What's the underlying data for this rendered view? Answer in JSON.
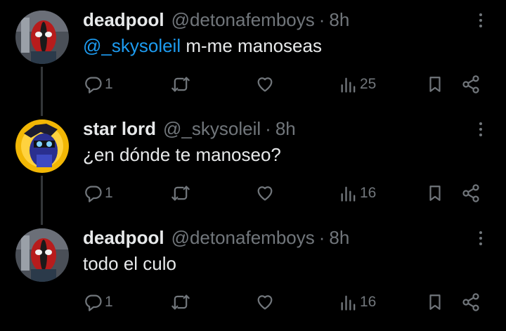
{
  "colors": {
    "background": "#000000",
    "text": "#e7e9ea",
    "muted": "#71767b",
    "link": "#1d9bf0",
    "thread_line": "#333639"
  },
  "tweets": [
    {
      "display_name": "deadpool",
      "handle": "@detonafemboys",
      "separator": "·",
      "time": "8h",
      "mention": "@_skysoleil",
      "text": "m-me manoseas",
      "replies": "1",
      "views": "25",
      "avatar": "deadpool-avatar"
    },
    {
      "display_name": "star lord",
      "handle": "@_skysoleil",
      "separator": "·",
      "time": "8h",
      "mention": "",
      "text": "¿en dónde te manoseo?",
      "replies": "1",
      "views": "16",
      "avatar": "star-lord-avatar"
    },
    {
      "display_name": "deadpool",
      "handle": "@detonafemboys",
      "separator": "·",
      "time": "8h",
      "mention": "",
      "text": "todo el culo",
      "replies": "1",
      "views": "16",
      "avatar": "deadpool-avatar"
    }
  ],
  "icons": [
    "reply-icon",
    "retweet-icon",
    "like-icon",
    "views-icon",
    "bookmark-icon",
    "share-icon",
    "more-icon"
  ]
}
